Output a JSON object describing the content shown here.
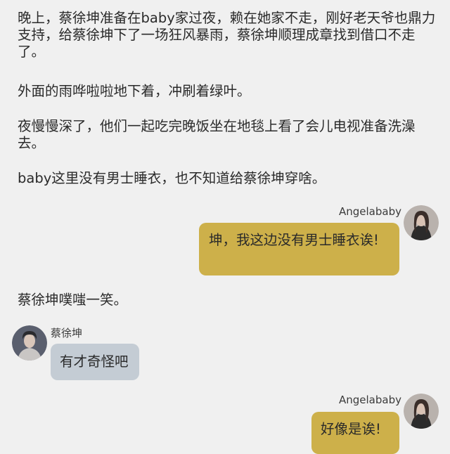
{
  "story": {
    "p1": "晚上，蔡徐坤准备在baby家过夜，赖在她家不走，刚好老天爷也鼎力支持，给蔡徐坤下了一场狂风暴雨，蔡徐坤顺理成章找到借口不走了。",
    "p2": "外面的雨哗啦啦地下着，冲刷着绿叶。",
    "p3": "夜慢慢深了，他们一起吃完晚饭坐在地毯上看了会儿电视准备洗澡去。",
    "p4": "baby这里没有男士睡衣，也不知道给蔡徐坤穿啥。",
    "p5": "蔡徐坤噗嗤一笑。"
  },
  "messages": [
    {
      "speaker": "Angelababy",
      "side": "right",
      "text": "坤，我这边没有男士睡衣诶!",
      "bubble_color": "#cdb04a"
    },
    {
      "speaker": "蔡徐坤",
      "side": "left",
      "text": "有才奇怪吧",
      "bubble_color": "#c4ccd4"
    },
    {
      "speaker": "Angelababy",
      "side": "right",
      "text": "好像是诶!",
      "bubble_color": "#cdb04a"
    }
  ],
  "colors": {
    "background": "#f0f0f0",
    "text": "#2a2a2a"
  }
}
